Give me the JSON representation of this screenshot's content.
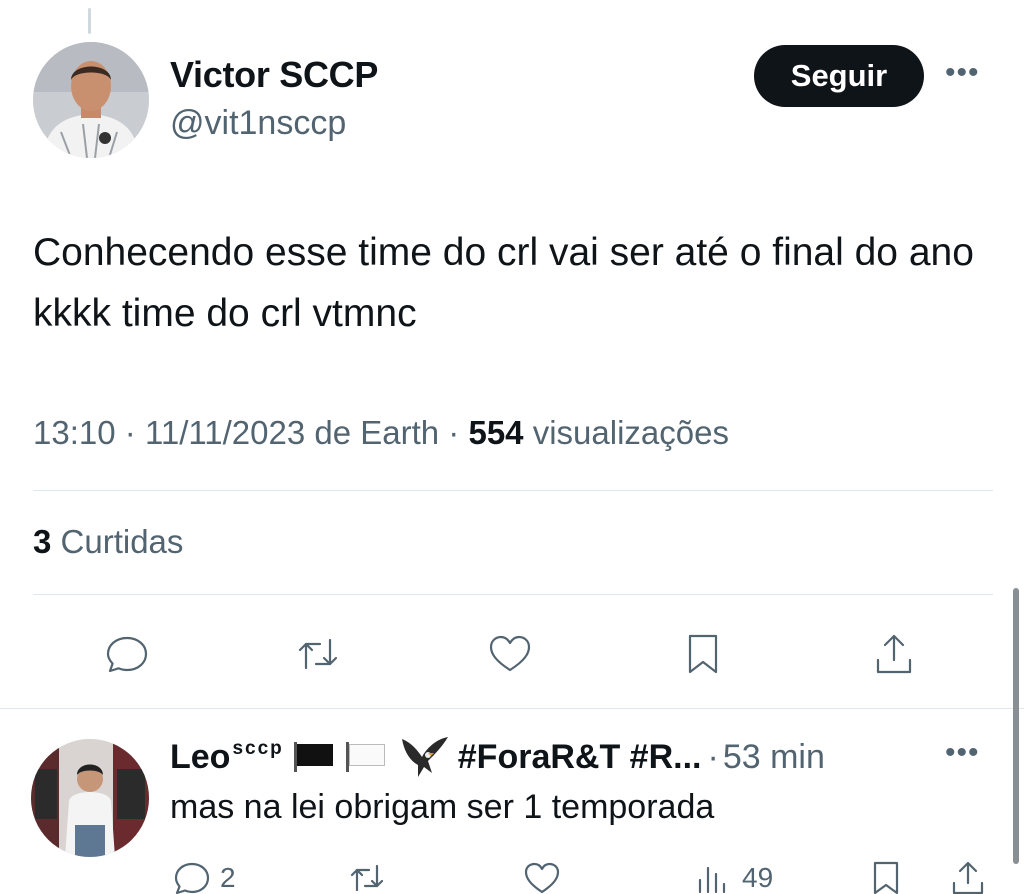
{
  "tweet": {
    "author_name": "Victor SCCP",
    "author_handle": "@vit1nsccp",
    "follow_label": "Seguir",
    "more_label": "•••",
    "text": "Conhecendo esse time do crl vai ser até o final do ano kkkk time do crl vtmnc",
    "time": "13:10",
    "sep1": "·",
    "date": "11/11/2023 de Earth",
    "sep2": "·",
    "views_count": "554",
    "views_label": "visualizações",
    "likes_count": "3",
    "likes_label": "Curtidas",
    "actions": [
      "reply-icon",
      "retweet-icon",
      "like-icon",
      "bookmark-icon",
      "share-icon"
    ]
  },
  "reply": {
    "name": "Leo",
    "name_sup": "sccp",
    "tag": "#ForaR&T #R...",
    "sep": "·",
    "time": "53 min",
    "more_label": "•••",
    "text": "mas na lei obrigam ser 1 temporada",
    "reply_count": "2",
    "views_count": "49"
  },
  "colors": {
    "text_primary": "#0f1419",
    "text_secondary": "#536471",
    "button_bg": "#0f1419",
    "divider": "#e1e8ed"
  }
}
